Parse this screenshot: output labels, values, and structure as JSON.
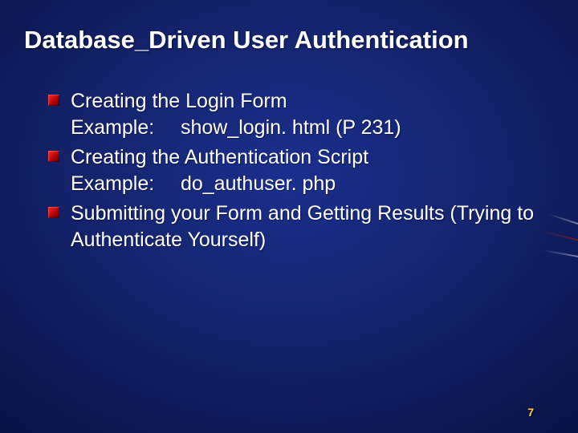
{
  "title": "Database_Driven User Authentication",
  "bullets": [
    {
      "main": "Creating the Login Form",
      "example_label": "Example:",
      "example_value": "show_login. html (P 231)"
    },
    {
      "main": "Creating the Authentication Script",
      "example_label": "Example:",
      "example_value": "do_authuser. php"
    },
    {
      "main": "Submitting your Form and Getting Results (Trying to Authenticate Yourself)"
    }
  ],
  "page_number": "7"
}
